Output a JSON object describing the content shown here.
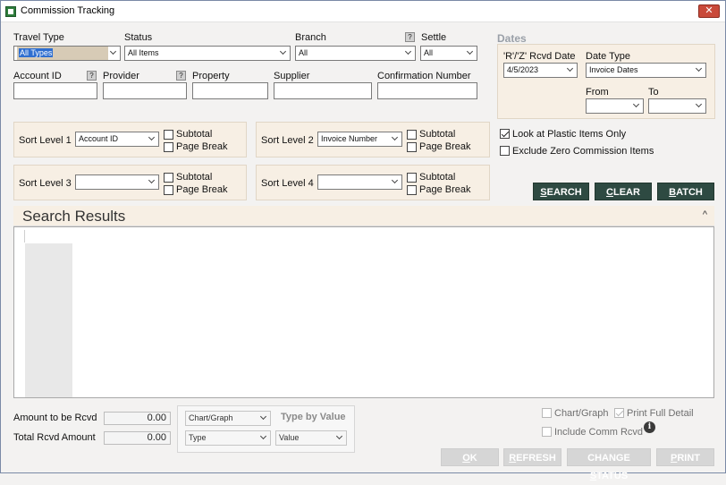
{
  "window": {
    "title": "Commission Tracking",
    "close_label": "✕"
  },
  "filters": {
    "travel_type": {
      "label": "Travel Type",
      "value": "All Types"
    },
    "status": {
      "label": "Status",
      "value": "All Items"
    },
    "branch": {
      "label": "Branch",
      "value": "All",
      "help": "?"
    },
    "settle": {
      "label": "Settle",
      "value": "All"
    },
    "account_id": {
      "label": "Account ID",
      "help": "?"
    },
    "provider": {
      "label": "Provider",
      "help": "?"
    },
    "property": {
      "label": "Property"
    },
    "supplier": {
      "label": "Supplier"
    },
    "confirmation_number": {
      "label": "Confirmation Number"
    }
  },
  "dates": {
    "title": "Dates",
    "rcvd_date": {
      "label": "'R'/'Z' Rcvd Date",
      "value": "4/5/2023"
    },
    "date_type": {
      "label": "Date Type",
      "value": "Invoice Dates"
    },
    "from": {
      "label": "From",
      "value": ""
    },
    "to": {
      "label": "To",
      "value": ""
    }
  },
  "sort_levels": [
    {
      "label": "Sort Level 1",
      "value": "Account ID",
      "subtotal": "Subtotal",
      "page_break": "Page Break"
    },
    {
      "label": "Sort Level 2",
      "value": "Invoice Number",
      "subtotal": "Subtotal",
      "page_break": "Page Break"
    },
    {
      "label": "Sort Level 3",
      "value": "",
      "subtotal": "Subtotal",
      "page_break": "Page Break"
    },
    {
      "label": "Sort Level 4",
      "value": "",
      "subtotal": "Subtotal",
      "page_break": "Page Break"
    }
  ],
  "options": {
    "plastic_only": {
      "label": "Look at Plastic Items Only",
      "checked": true
    },
    "exclude_zero": {
      "label": "Exclude Zero Commission Items",
      "checked": false
    }
  },
  "actions": {
    "search": {
      "label_ul": "S",
      "label_rest": "EARCH"
    },
    "clear": {
      "label_ul": "C",
      "label_rest": "LEAR"
    },
    "batch": {
      "label_ul": "B",
      "label_rest": "ATCH"
    }
  },
  "results": {
    "title": "Search Results",
    "collapse_glyph": "^"
  },
  "totals": {
    "amount_to_be_rcvd": {
      "label": "Amount to be Rcvd",
      "value": "0.00"
    },
    "total_rcvd_amount": {
      "label": "Total Rcvd Amount",
      "value": "0.00"
    }
  },
  "chart": {
    "chart_graph_select": "Chart/Graph",
    "type_select": "Type",
    "type_by_value_label": "Type by Value",
    "value_select": "Value"
  },
  "footer_options": {
    "chart_graph": {
      "label": "Chart/Graph",
      "checked": false
    },
    "print_full_detail": {
      "label": "Print Full Detail",
      "checked": true
    },
    "include_comm_rcvd": {
      "label": "Include Comm Rcvd",
      "checked": false
    },
    "info_glyph": "i"
  },
  "footer_buttons": {
    "ok": {
      "label_ul": "O",
      "label_rest": "K"
    },
    "refresh": {
      "label_ul": "R",
      "label_rest": "EFRESH"
    },
    "change_status": {
      "label_pre": "CHANGE ",
      "label_ul": "S",
      "label_rest": "TATUS"
    },
    "print": {
      "label_ul": "P",
      "label_rest": "RINT"
    }
  },
  "colors": {
    "panel_bg": "#f7efe4",
    "dark_button": "#2e4a42",
    "close_button": "#c94a3a",
    "disabled_button": "#d6d6d6"
  }
}
